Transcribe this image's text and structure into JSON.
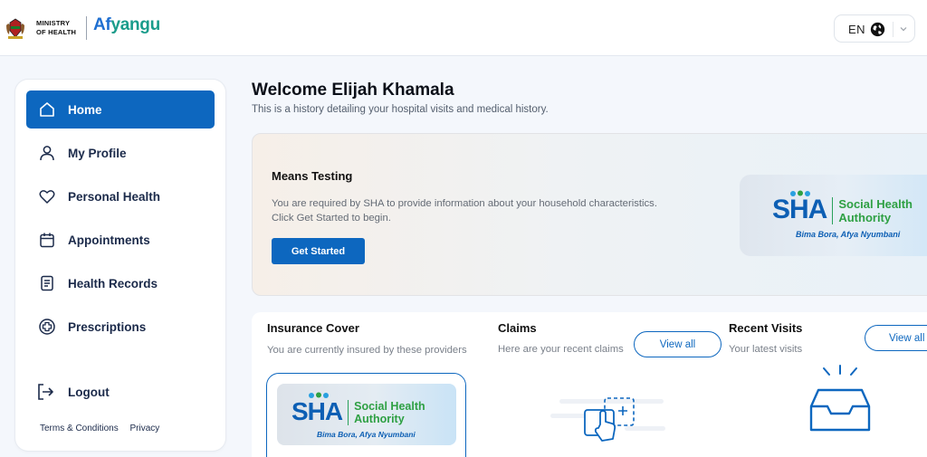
{
  "header": {
    "ministry_line1": "MINISTRY",
    "ministry_line2": "OF HEALTH",
    "brand_part1": "Af",
    "brand_part2": "yangu",
    "language": "EN"
  },
  "sidebar": {
    "items": [
      {
        "label": "Home",
        "icon": "home-icon",
        "active": true
      },
      {
        "label": "My Profile",
        "icon": "user-icon"
      },
      {
        "label": "Personal Health",
        "icon": "heart-icon"
      },
      {
        "label": "Appointments",
        "icon": "calendar-icon"
      },
      {
        "label": "Health Records",
        "icon": "document-icon"
      },
      {
        "label": "Prescriptions",
        "icon": "plus-circle-icon"
      }
    ],
    "logout_label": "Logout",
    "terms_label": "Terms & Conditions",
    "privacy_label": "Privacy"
  },
  "main": {
    "welcome": "Welcome Elijah Khamala",
    "welcome_sub": "This is a history detailing your hospital visits and medical history.",
    "means_testing": {
      "title": "Means Testing",
      "description": "You are required by SHA to provide information about your household characteristics. Click Get Started to begin.",
      "button": "Get Started"
    },
    "sha_logo": {
      "mark": "SHA",
      "name_line1": "Social Health",
      "name_line2": "Authority",
      "tagline": "Bima Bora, Afya Nyumbani"
    },
    "insurance": {
      "title": "Insurance Cover",
      "subtitle": "You are currently insured by these providers"
    },
    "claims": {
      "title": "Claims",
      "subtitle": "Here are your recent claims",
      "button": "View all"
    },
    "recent_visits": {
      "title": "Recent Visits",
      "subtitle": "Your latest visits",
      "button": "View all"
    }
  },
  "colors": {
    "primary": "#0d67bf",
    "sha_blue": "#0d5fb4",
    "sha_green": "#2ea043",
    "afyangu_teal": "#1a9c8b"
  }
}
